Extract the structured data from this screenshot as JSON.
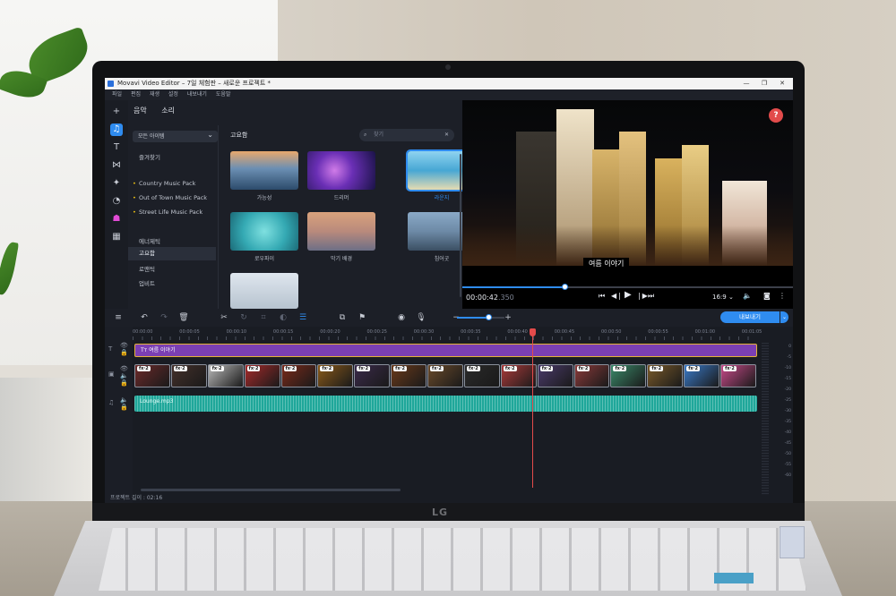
{
  "window": {
    "title": "Movavi Video Editor – 7일 체험판 – 새로운 프로젝트 *",
    "controls": [
      "—",
      "❐",
      "✕"
    ]
  },
  "menu": [
    "파일",
    "편집",
    "재생",
    "설정",
    "내보내기",
    "도움말"
  ],
  "sidebar_icons": [
    "plus-icon",
    "music-icon",
    "text-icon",
    "transition-icon",
    "effects-icon",
    "filter-icon",
    "sticker-icon",
    "grid-icon"
  ],
  "media_panel": {
    "tabs": [
      "음악",
      "소리"
    ],
    "filter_value": "모든 아이템",
    "favorites": "즐겨찾기",
    "packs": [
      "Country Music Pack",
      "Out of Town Music Pack",
      "Street Life Music Pack"
    ],
    "genres": [
      "에너제틱",
      "고요함",
      "로맨틱",
      "업비트"
    ],
    "selected_genre": "고요함",
    "section_title": "고요함",
    "search_placeholder": "찾기",
    "items": [
      {
        "label": "가능성"
      },
      {
        "label": "드리머"
      },
      {
        "label": "라운지"
      },
      {
        "label": "로우파이"
      },
      {
        "label": "막기 배경"
      },
      {
        "label": "침어굿"
      },
      {
        "label": ""
      }
    ]
  },
  "player": {
    "subtitle": "여름 이야기",
    "time_main": "00:00:42",
    "time_ms": ".350",
    "aspect": "16:9 ⌄",
    "progress": 0.31
  },
  "timeline": {
    "export_label": "내보내기",
    "ruler": [
      "00:00:00",
      "00:00:05",
      "00:00:10",
      "00:00:15",
      "00:00:20",
      "00:00:25",
      "00:00:30",
      "00:00:35",
      "00:00:40",
      "00:00:45",
      "00:00:50",
      "00:00:55",
      "00:01:00",
      "00:01:05"
    ],
    "title_clip": "여름 이야기",
    "fx_badge": "fx·2",
    "audio_clip": "Lounge.mp3",
    "meter_ticks": [
      "0",
      "-5",
      "-10",
      "-15",
      "-20",
      "-25",
      "-30",
      "-35",
      "-40",
      "-45",
      "-50",
      "-55",
      "-60"
    ],
    "project_length": "프로젝트 길이 : 02:16"
  }
}
